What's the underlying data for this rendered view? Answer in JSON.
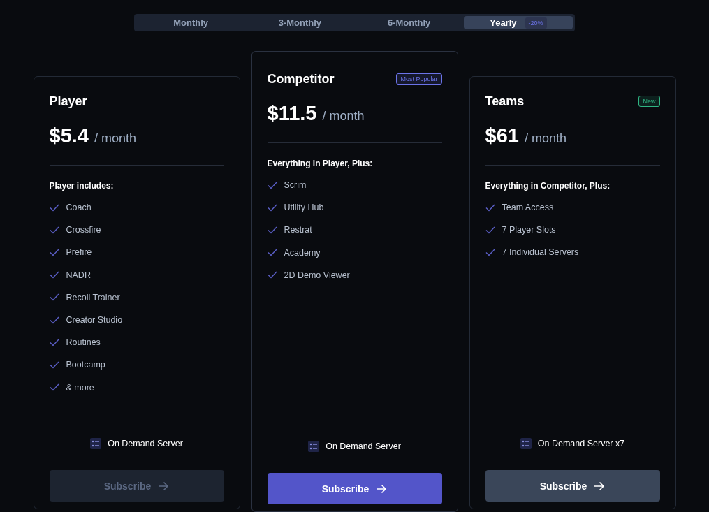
{
  "billing_tabs": [
    {
      "label": "Monthly",
      "selected": false
    },
    {
      "label": "3-Monthly",
      "selected": false
    },
    {
      "label": "6-Monthly",
      "selected": false
    },
    {
      "label": "Yearly",
      "selected": true,
      "badge": "-20%"
    }
  ],
  "plans": [
    {
      "name": "Player",
      "featured": false,
      "price": "$5.4",
      "period": "/ month",
      "features_heading": "Player includes:",
      "features": [
        "Coach",
        "Crossfire",
        "Prefire",
        "NADR",
        "Recoil Trainer",
        "Creator Studio",
        "Routines",
        "Bootcamp",
        "& more"
      ],
      "server": "On Demand Server",
      "button": {
        "label": "Subscribe",
        "kind": "disabled"
      }
    },
    {
      "name": "Competitor",
      "featured": true,
      "badge": {
        "label": "Most Popular",
        "color": "#6b73e8"
      },
      "price": "$11.5",
      "period": "/ month",
      "features_heading": "Everything in Player, Plus:",
      "features": [
        "Scrim",
        "Utility Hub",
        "Restrat",
        "Academy",
        "2D Demo Viewer"
      ],
      "server": "On Demand Server",
      "button": {
        "label": "Subscribe",
        "kind": "primary"
      }
    },
    {
      "name": "Teams",
      "featured": false,
      "badge": {
        "label": "New",
        "color": "#2fb583"
      },
      "price": "$61",
      "period": "/ month",
      "features_heading": "Everything in Competitor, Plus:",
      "features": [
        "Team Access",
        "7 Player Slots",
        "7 Individual Servers"
      ],
      "server": "On Demand Server x7",
      "button": {
        "label": "Subscribe",
        "kind": "secondary"
      }
    }
  ]
}
